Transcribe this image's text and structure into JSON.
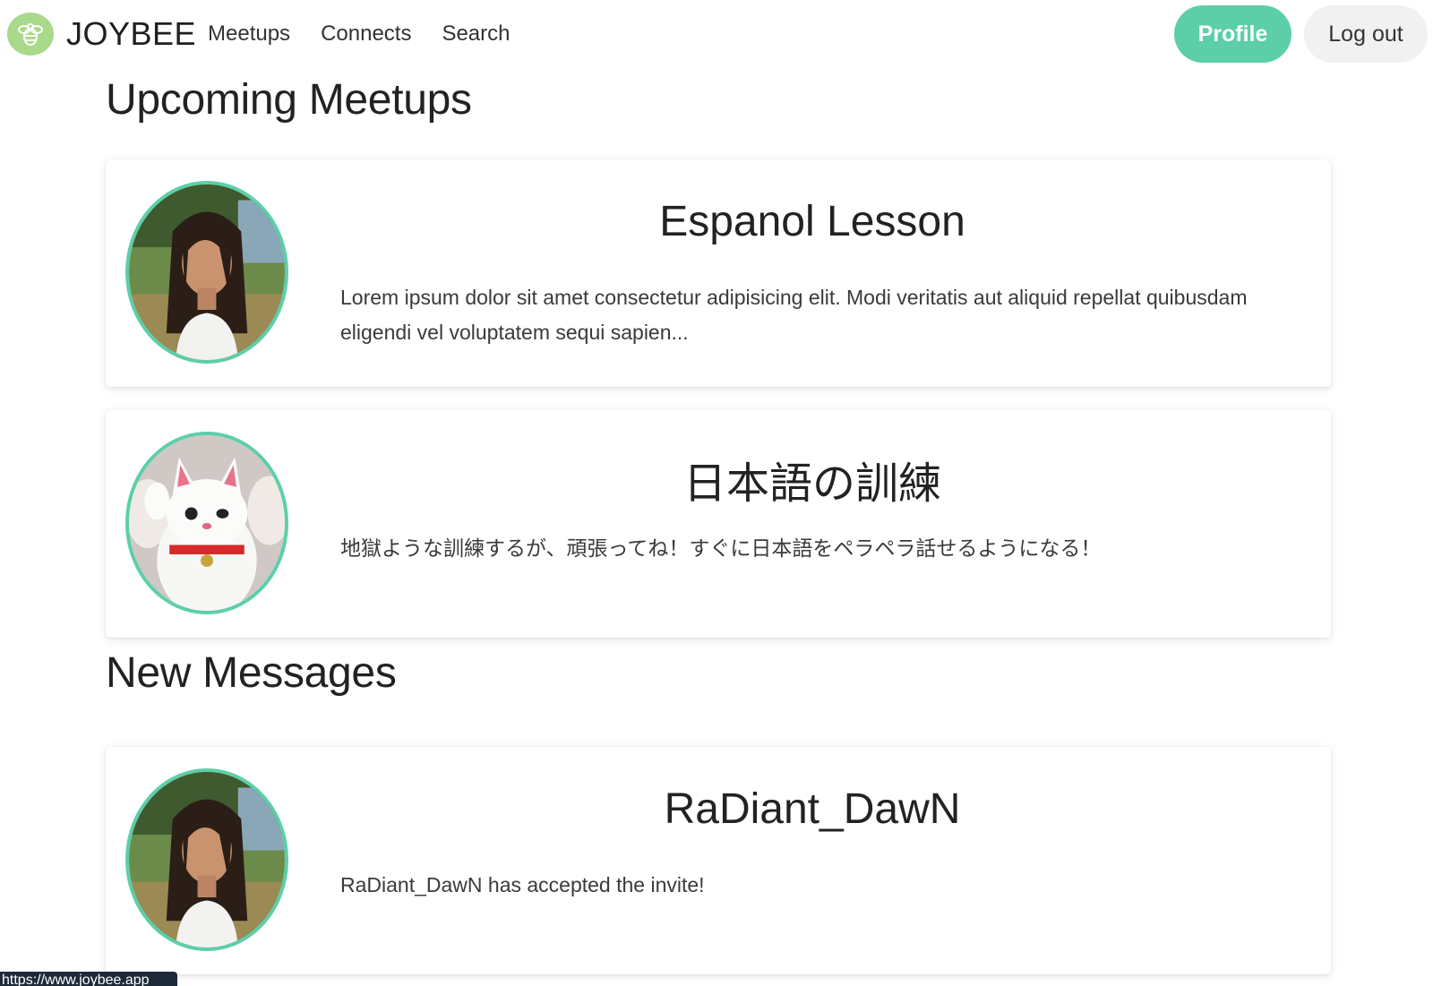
{
  "brand": {
    "name": "JOYBEE",
    "logo_icon": "bee-icon",
    "logo_color": "#a9d98a"
  },
  "nav": {
    "links": [
      "Meetups",
      "Connects",
      "Search"
    ],
    "profile_label": "Profile",
    "logout_label": "Log out"
  },
  "colors": {
    "accent": "#5ccfa8"
  },
  "sections": {
    "meetups_title": "Upcoming Meetups",
    "messages_title": "New Messages"
  },
  "meetups": [
    {
      "title": "Espanol Lesson",
      "text": "Lorem ipsum dolor sit amet consectetur adipisicing elit. Modi veritatis aut aliquid repellat quibusdam eligendi vel voluptatem sequi sapien...",
      "avatar": "woman-portrait-avatar"
    },
    {
      "title": "日本語の訓練",
      "text": "地獄ような訓練するが、頑張ってね！すぐに日本語をペラペラ話せるようになる！",
      "avatar": "lucky-cat-avatar"
    }
  ],
  "messages": [
    {
      "title": "RaDiant_DawN",
      "text": "RaDiant_DawN has accepted the invite!",
      "avatar": "woman-portrait-avatar"
    }
  ],
  "status_bar": {
    "url": "https://www.joybee.app"
  }
}
